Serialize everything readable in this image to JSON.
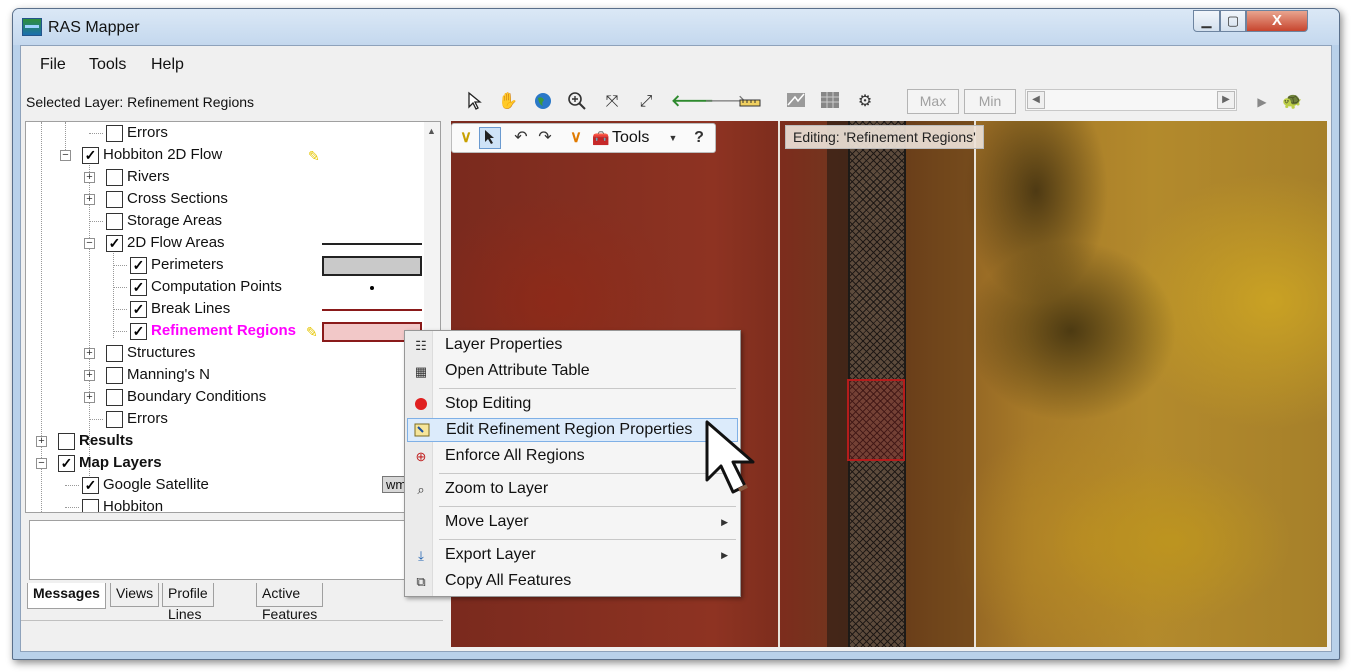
{
  "window": {
    "title": "RAS Mapper",
    "min_glyph": "▁",
    "max_glyph": "▢",
    "close_glyph": "X"
  },
  "menu": {
    "file": "File",
    "tools": "Tools",
    "help": "Help"
  },
  "selected_layer": "Selected Layer: Refinement Regions",
  "map_toolbar": {
    "max_label": "Max",
    "min_label": "Min",
    "icons": [
      "select-arrow-icon",
      "pan-hand-icon",
      "globe-icon",
      "zoom-in-icon",
      "zoom-extent-icon",
      "full-extent-icon",
      "back-arrow-icon",
      "forward-arrow-icon",
      "measure-ruler-icon",
      "profile-line-icon",
      "grid-icon",
      "settings-tool-icon"
    ]
  },
  "tree": {
    "errors_top": "Errors",
    "hobbiton_2d_flow": "Hobbiton 2D Flow",
    "rivers": "Rivers",
    "cross_sections": "Cross Sections",
    "storage_areas": "Storage Areas",
    "flow_areas_2d": "2D Flow Areas",
    "perimeters": "Perimeters",
    "computation_points": "Computation Points",
    "break_lines": "Break Lines",
    "refinement_regions": "Refinement Regions",
    "structures": "Structures",
    "mannings_n": "Manning's N",
    "boundary_conditions": "Boundary Conditions",
    "errors_bottom": "Errors",
    "results": "Results",
    "map_layers": "Map Layers",
    "google_satellite": "Google Satellite",
    "wms_badge": "wms",
    "hobbiton": "Hobbiton"
  },
  "bottom_tabs": {
    "messages": "Messages",
    "views": "Views",
    "profile_lines": "Profile Lines",
    "active_features": "Active Features"
  },
  "edit_toolbar": {
    "tools_label": "Tools",
    "help_glyph": "?"
  },
  "editing_label": "Editing: 'Refinement Regions'",
  "context_menu": {
    "layer_properties": "Layer Properties",
    "open_attribute_table": "Open Attribute Table",
    "stop_editing": "Stop Editing",
    "edit_refinement_region_properties": "Edit Refinement Region Properties",
    "enforce_all_regions": "Enforce All Regions",
    "zoom_to_layer": "Zoom to Layer",
    "move_layer": "Move Layer",
    "export_layer": "Export Layer",
    "copy_all_features": "Copy All Features"
  },
  "colors": {
    "highlight_text": "#ff00ff",
    "refinement_border": "#b51c1c",
    "stop_editing_red": "#e02020"
  }
}
